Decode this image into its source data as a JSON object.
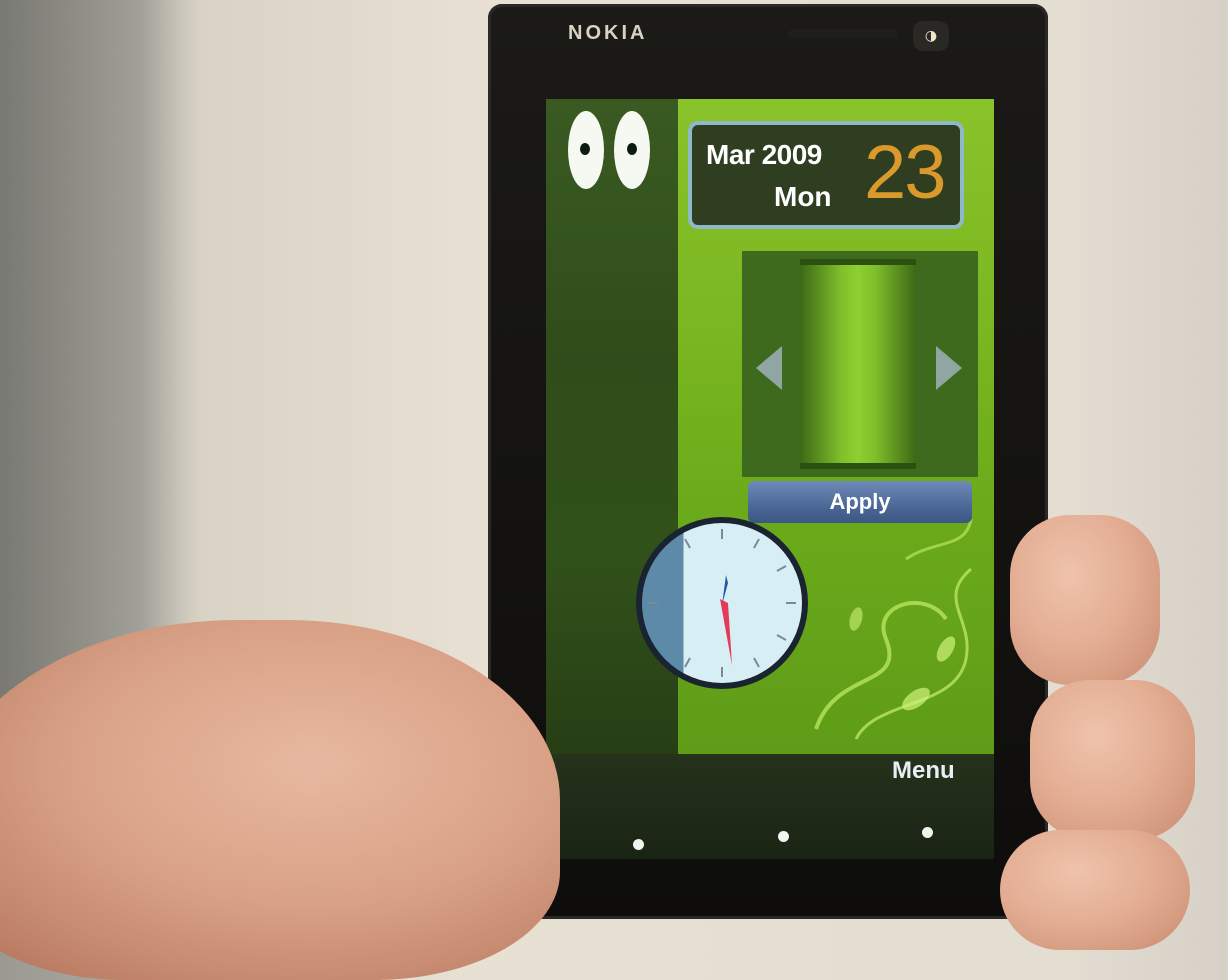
{
  "device": {
    "brand": "NOKIA",
    "sensor_icon": "proximity-sensor-icon"
  },
  "widgets": {
    "eyes_icon": "cartoon-eyes-icon",
    "date": {
      "month_year": "Mar 2009",
      "weekday": "Mon",
      "day": "23"
    },
    "picker": {
      "left_arrow_icon": "arrow-left-icon",
      "right_arrow_icon": "arrow-right-icon"
    },
    "apply_label": "Apply",
    "clock_icon": "analog-clock-icon"
  },
  "softkeys": {
    "menu_label": "Menu"
  },
  "colors": {
    "accent_green": "#7ab721",
    "day_number": "#d99a2b",
    "button_blue": "#4c6896"
  }
}
